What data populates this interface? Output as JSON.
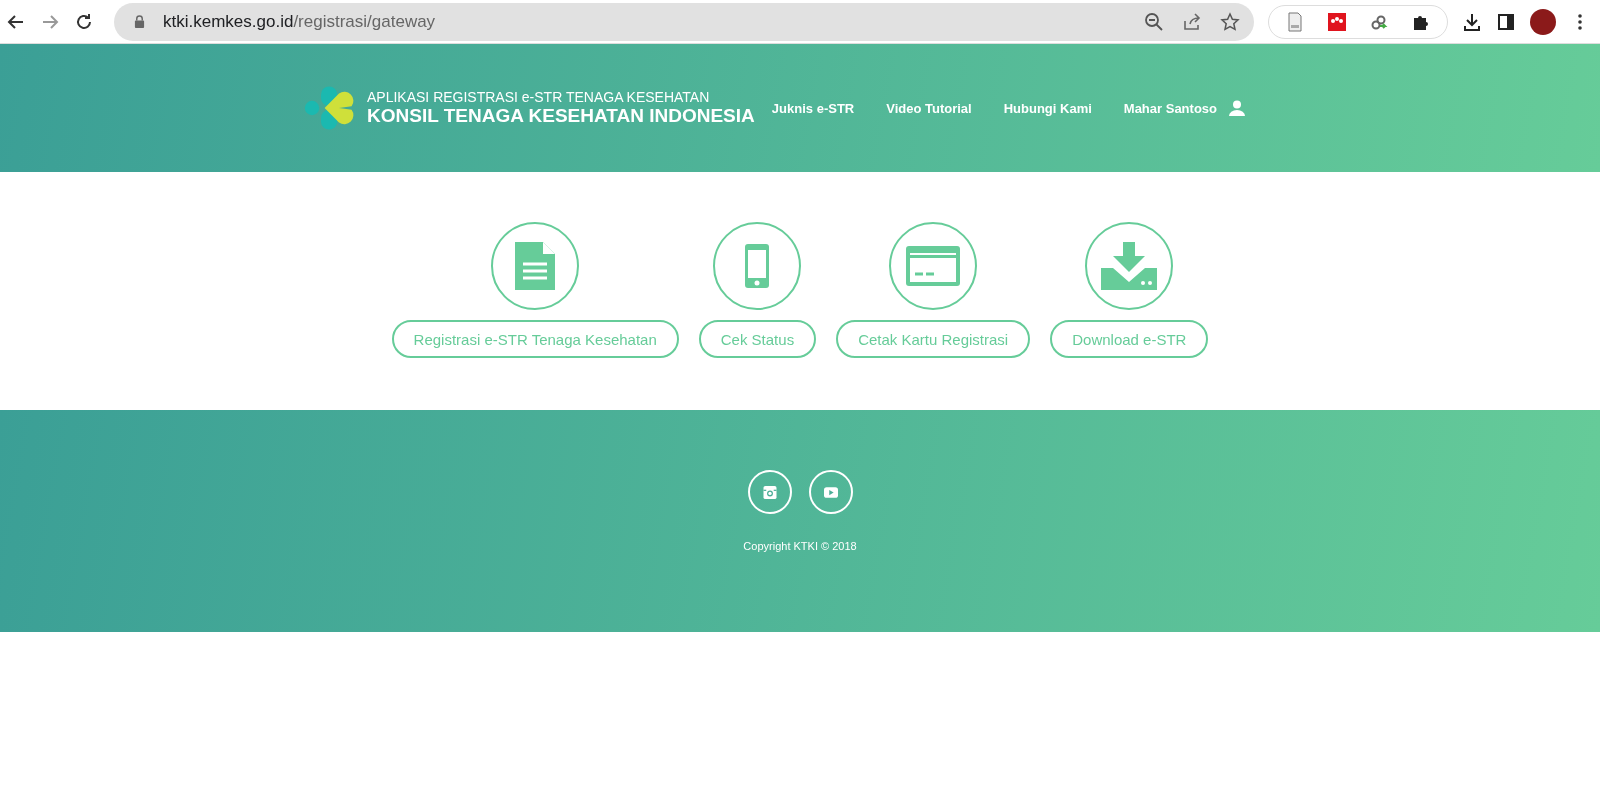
{
  "browser": {
    "url_domain": "ktki.kemkes.go.id",
    "url_path": "/registrasi/gateway"
  },
  "header": {
    "logo_subtitle": "APLIKASI REGISTRASI e-STR TENAGA KESEHATAN",
    "logo_title": "KONSIL TENAGA KESEHATAN INDONESIA",
    "nav": [
      {
        "label": "Juknis e-STR"
      },
      {
        "label": "Video Tutorial"
      },
      {
        "label": "Hubungi Kami"
      }
    ],
    "user": "Mahar Santoso"
  },
  "services": [
    {
      "kind": "document",
      "label": "Registrasi e-STR Tenaga Kesehatan"
    },
    {
      "kind": "phone",
      "label": "Cek Status"
    },
    {
      "kind": "card",
      "label": "Cetak Kartu Registrasi"
    },
    {
      "kind": "download",
      "label": "Download e-STR"
    }
  ],
  "footer": {
    "social": [
      {
        "kind": "instagram"
      },
      {
        "kind": "youtube"
      }
    ],
    "copyright": "Copyright KTKI © 2018"
  }
}
